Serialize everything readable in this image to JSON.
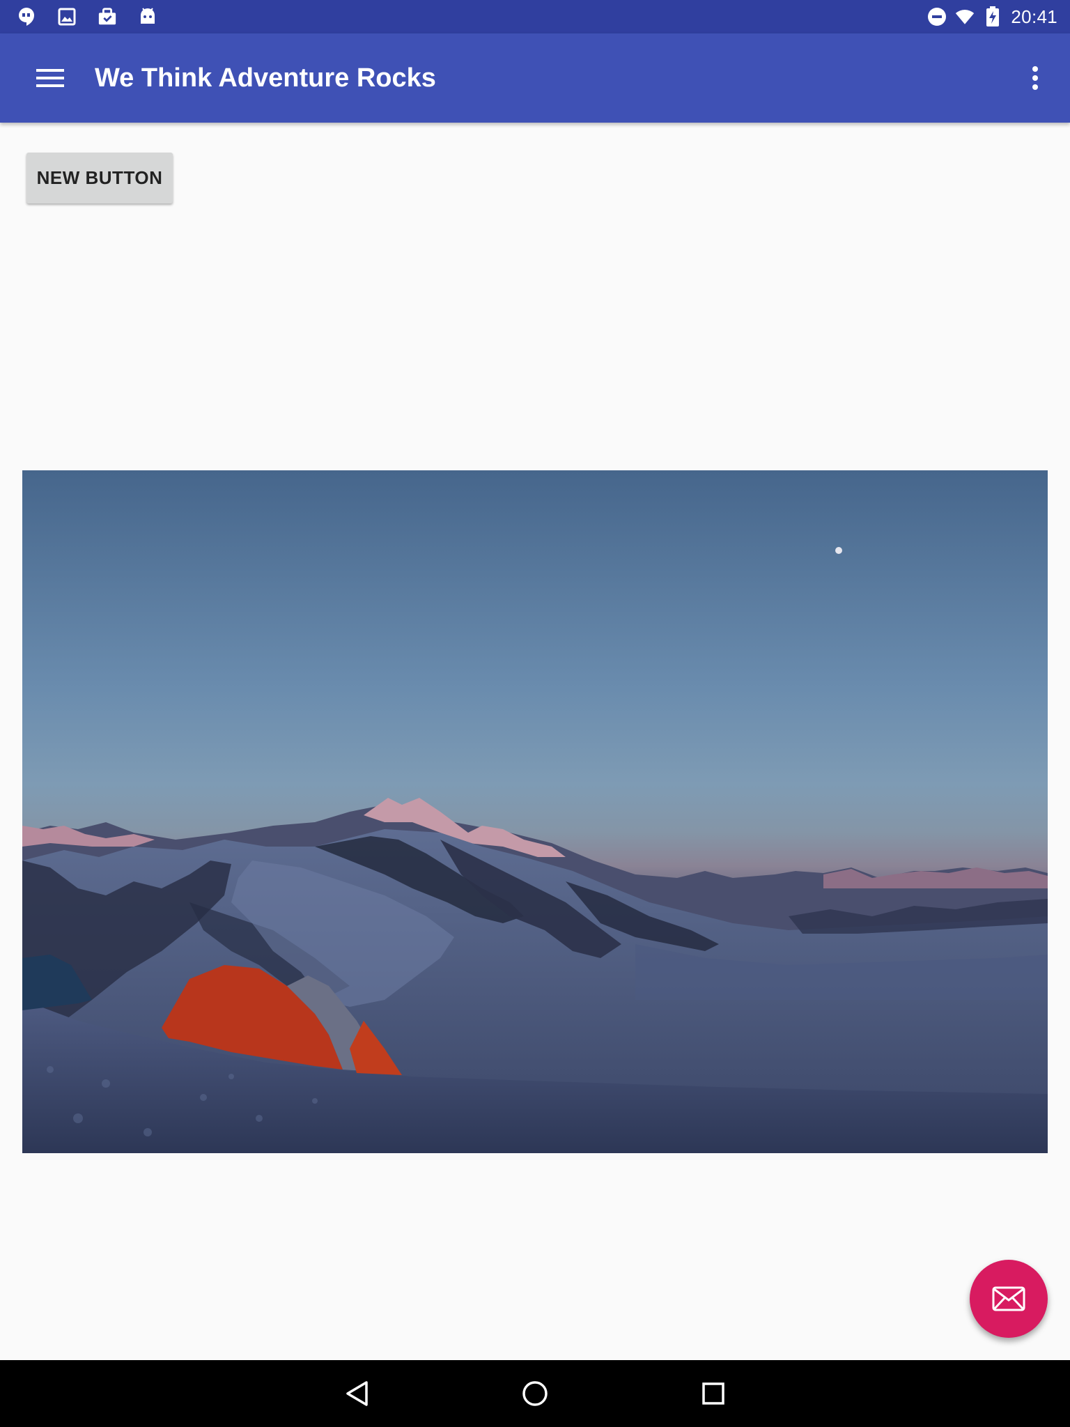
{
  "status_bar": {
    "time": "20:41",
    "left_icons": [
      "hangouts-icon",
      "image-icon",
      "store-icon",
      "android-icon"
    ],
    "right_icons": [
      "do-not-disturb-icon",
      "wifi-icon",
      "battery-charging-icon"
    ]
  },
  "app_bar": {
    "title": "We Think Adventure Rocks",
    "menu_icon": "menu-icon",
    "overflow_icon": "more-vert-icon"
  },
  "main": {
    "button_label": "NEW BUTTON"
  },
  "fab": {
    "icon": "email-icon",
    "color": "#d81b60"
  },
  "nav_bar": {
    "buttons": [
      "back-icon",
      "home-icon",
      "recents-icon"
    ]
  },
  "colors": {
    "status_bar": "#303f9f",
    "app_bar": "#3f51b5",
    "background": "#fafafa",
    "accent": "#d81b60"
  }
}
